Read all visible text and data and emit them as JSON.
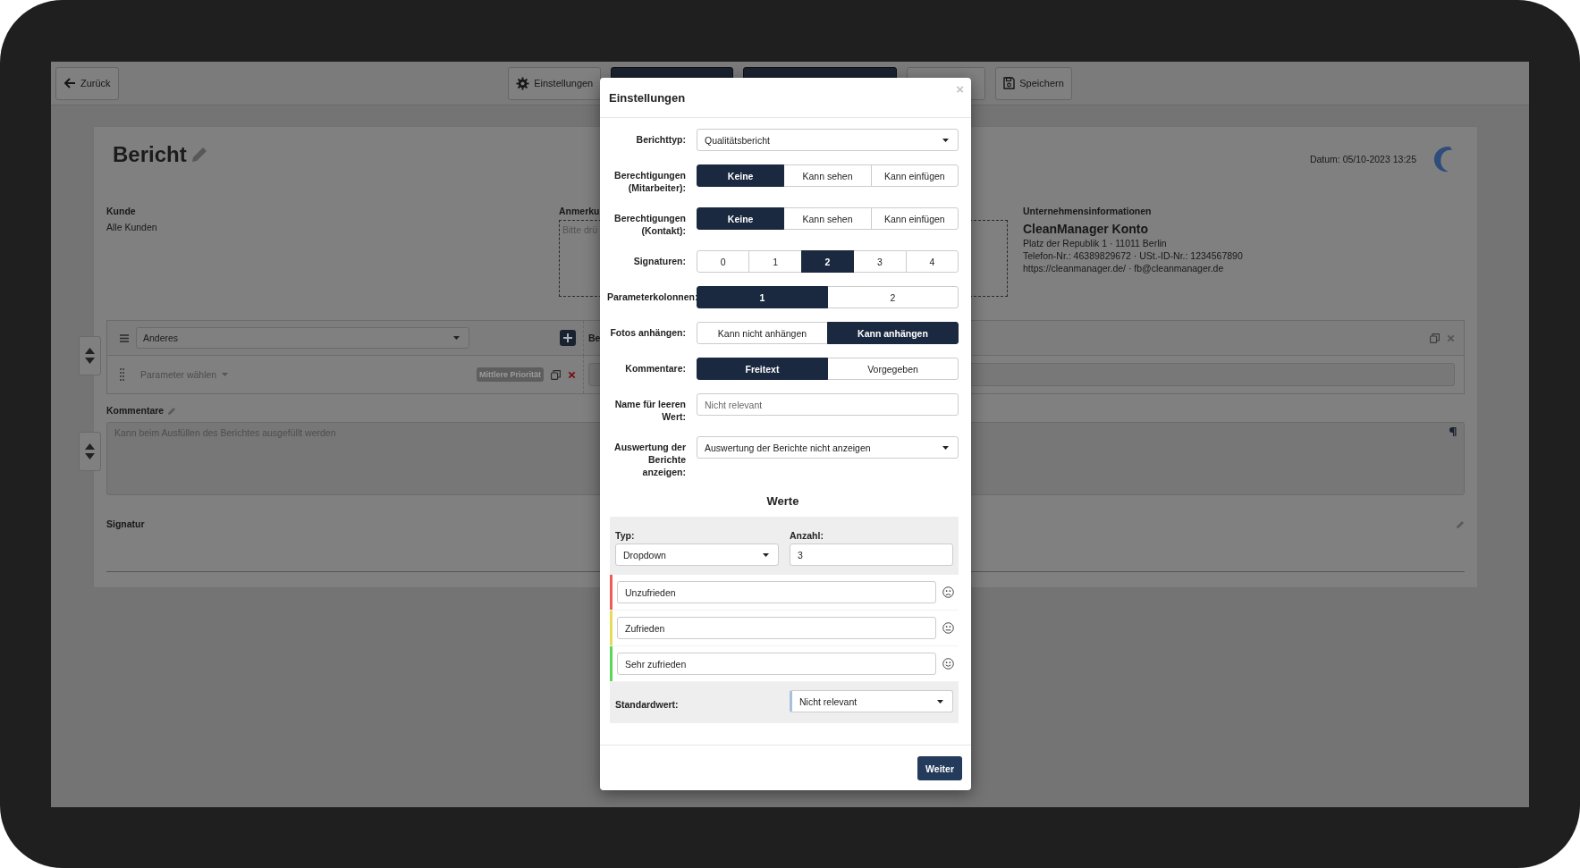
{
  "toolbar": {
    "buttons": [
      {
        "kind": "back",
        "label": "Zurück"
      },
      {
        "kind": "settings",
        "label": "Einstellungen"
      },
      {
        "kind": "primary"
      },
      {
        "kind": "primary"
      },
      {
        "kind": "preview"
      },
      {
        "kind": "save",
        "label": "Speichern"
      }
    ]
  },
  "report": {
    "title": "Bericht",
    "date": "Datum: 05/10-2023 13:25",
    "customer": {
      "label": "Kunde",
      "value": "Alle Kunden"
    },
    "note": {
      "label": "Anmerku",
      "placeholder": "Bitte drü"
    },
    "company": {
      "label": "Unternehmensinformationen",
      "name": "CleanManager Konto",
      "lines": [
        "Platz der Republik 1 · 11011 Berlin",
        "Telefon-Nr.: 46389829672 · USt.-ID-Nr.: 1234567890",
        "https://cleanmanager.de/ · fb@cleanmanager.de"
      ]
    },
    "parameter": {
      "category": "Anderes",
      "right_label": "Be",
      "select": "Parameter wählen",
      "priority": "Mittlere Priorität"
    },
    "comments": {
      "label": "Kommentare",
      "placeholder": "Kann beim Ausfüllen des Berichtes ausgefüllt werden"
    },
    "signature": {
      "label": "Signatur"
    }
  },
  "dialog": {
    "title": "Einstellungen",
    "close": "×",
    "fields": [
      {
        "kind": "select",
        "label": "Berichttyp:",
        "value": "Qualitätsbericht"
      },
      {
        "kind": "segments",
        "label": "Berechtigungen (Mitarbeiter):",
        "options": [
          {
            "label": "Keine",
            "selected": true
          },
          {
            "label": "Kann sehen",
            "selected": false
          },
          {
            "label": "Kann einfügen",
            "selected": false
          }
        ]
      },
      {
        "kind": "segments",
        "label": "Berechtigungen (Kontakt):",
        "options": [
          {
            "label": "Keine",
            "selected": true
          },
          {
            "label": "Kann sehen",
            "selected": false
          },
          {
            "label": "Kann einfügen",
            "selected": false
          }
        ]
      },
      {
        "kind": "segments",
        "label": "Signaturen:",
        "options": [
          {
            "label": "0",
            "selected": false
          },
          {
            "label": "1",
            "selected": false
          },
          {
            "label": "2",
            "selected": true
          },
          {
            "label": "3",
            "selected": false
          },
          {
            "label": "4",
            "selected": false
          }
        ]
      },
      {
        "kind": "segments",
        "label": "Parameterkolonnen:",
        "options": [
          {
            "label": "1",
            "selected": true
          },
          {
            "label": "2",
            "selected": false
          }
        ]
      },
      {
        "kind": "segments",
        "label": "Fotos anhängen:",
        "options": [
          {
            "label": "Kann nicht anhängen",
            "selected": false
          },
          {
            "label": "Kann anhängen",
            "selected": true
          }
        ]
      },
      {
        "kind": "segments",
        "label": "Kommentare:",
        "options": [
          {
            "label": "Freitext",
            "selected": true
          },
          {
            "label": "Vorgegeben",
            "selected": false
          }
        ]
      },
      {
        "kind": "input",
        "label": "Name für leeren Wert:",
        "placeholder": "Nicht relevant"
      },
      {
        "kind": "select",
        "label": "Auswertung der Berichte anzeigen:",
        "value": "Auswertung der Berichte nicht anzeigen"
      }
    ],
    "values": {
      "title": "Werte",
      "type": {
        "label": "Typ:",
        "value": "Dropdown"
      },
      "count": {
        "label": "Anzahl:",
        "value": "3"
      },
      "items": [
        {
          "kind": "sad",
          "value": "Unzufrieden",
          "color": "#f05a5a"
        },
        {
          "kind": "neutral",
          "value": "Zufrieden",
          "color": "#e3dc5a"
        },
        {
          "kind": "happy",
          "value": "Sehr zufrieden",
          "color": "#5bd65b"
        }
      ],
      "default": {
        "label": "Standardwert:",
        "value": "Nicht relevant"
      }
    },
    "submit": "Weiter"
  }
}
